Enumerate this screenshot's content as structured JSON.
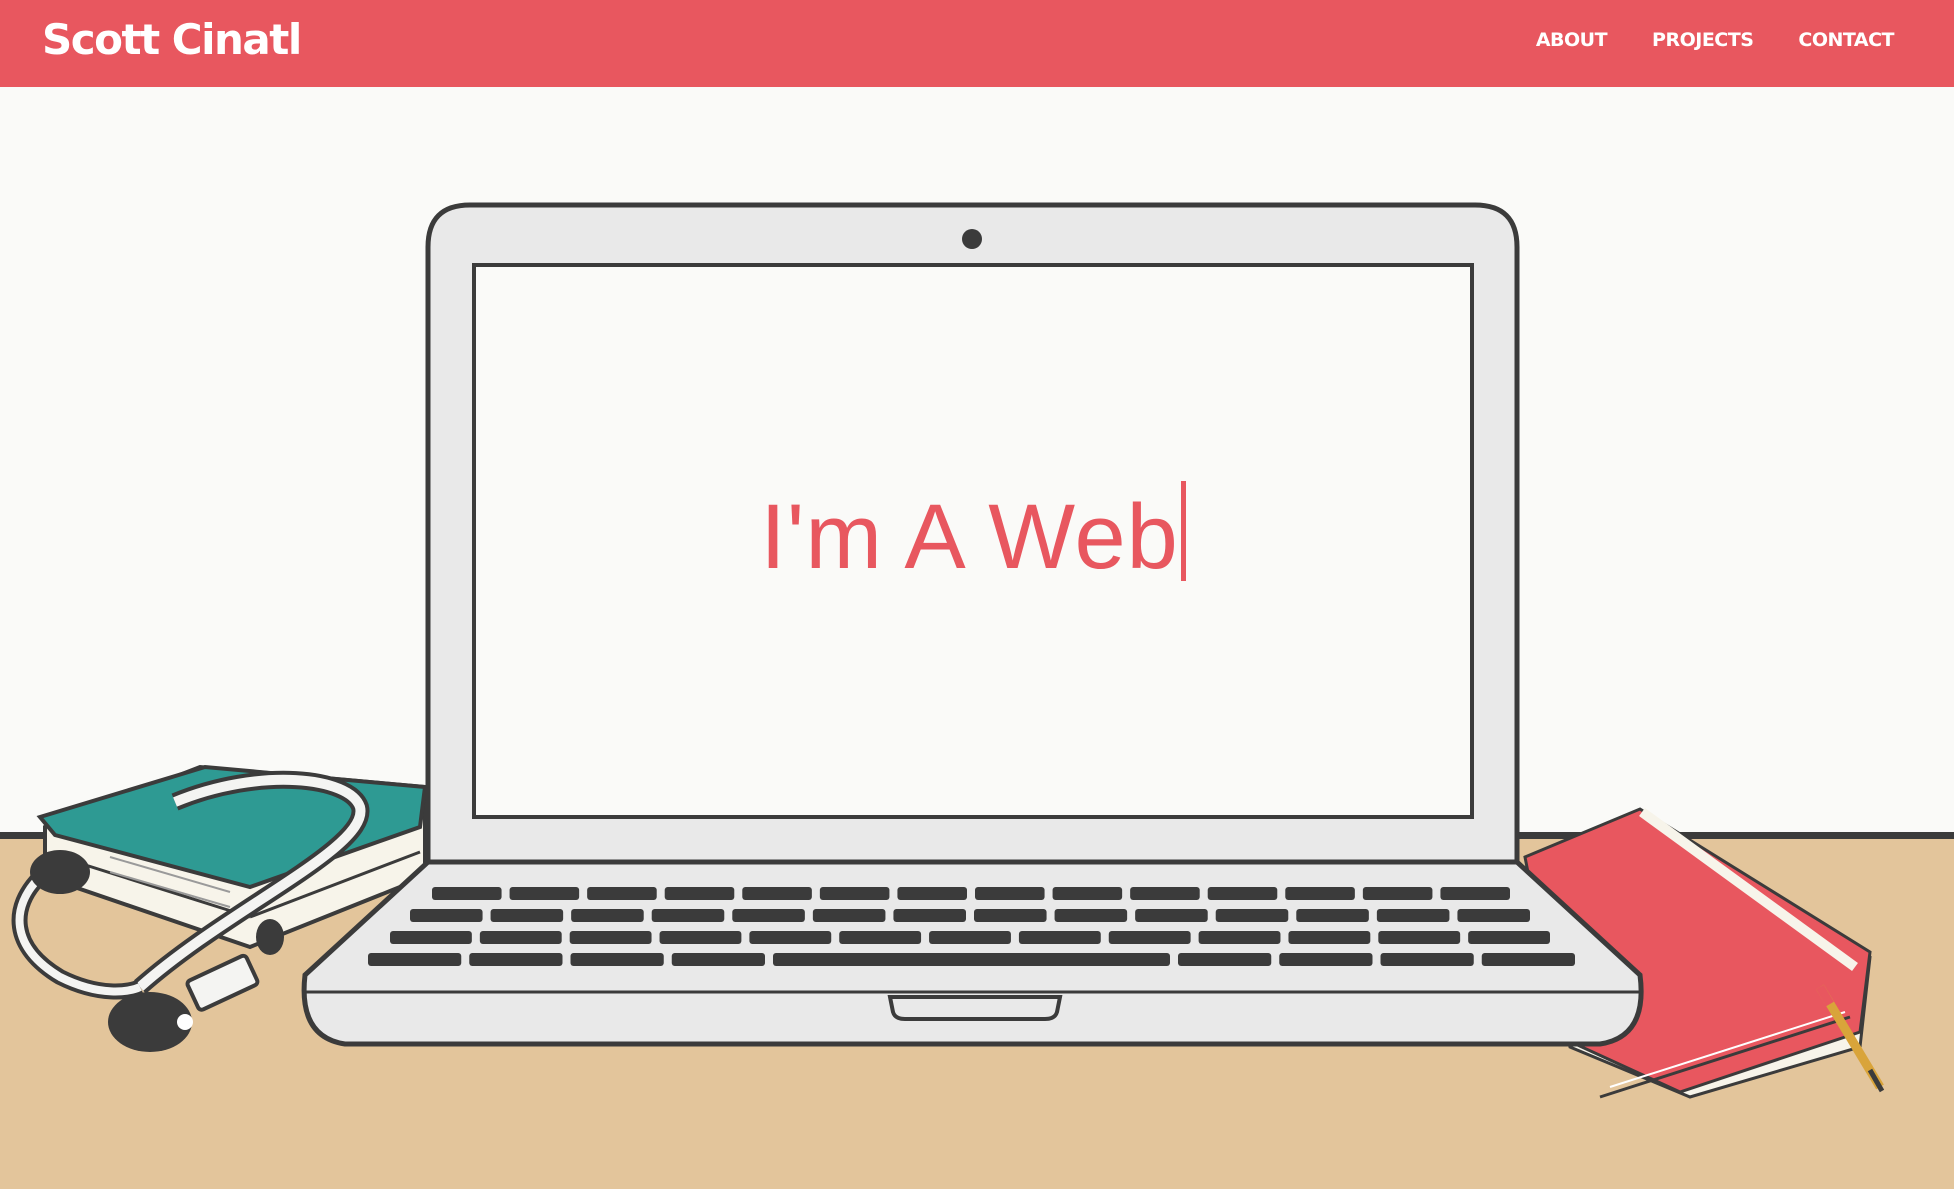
{
  "header": {
    "brand": "Scott Cinatl",
    "nav": [
      {
        "label": "ABOUT"
      },
      {
        "label": "PROJECTS"
      },
      {
        "label": "CONTACT"
      }
    ]
  },
  "hero": {
    "headline": "I'm A Web"
  },
  "colors": {
    "accent": "#e8575f",
    "background": "#fafaf8",
    "desk": "#e3c59b",
    "book_teal": "#2e9a93",
    "notebook_red": "#e8575f",
    "outline": "#3b3b3b"
  },
  "icons": [
    "laptop-illustration",
    "book-illustration",
    "headphones-illustration",
    "notebook-illustration",
    "pencil-illustration"
  ]
}
